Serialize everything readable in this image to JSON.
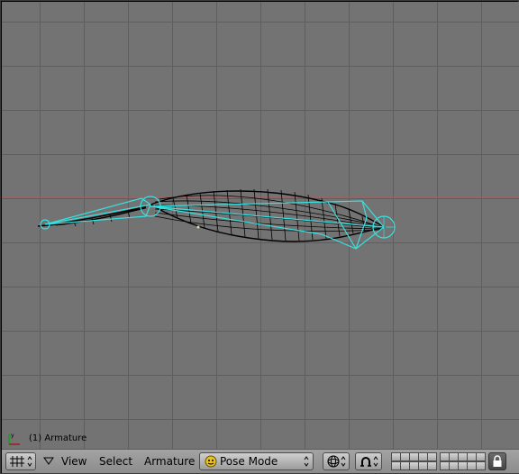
{
  "viewport": {
    "object_info": "(1) Armature",
    "axis_label": "y",
    "colors": {
      "background": "#737373",
      "grid": "#5e5e5e",
      "x_axis": "#b25a5a",
      "armature": "#38e0e0",
      "mesh": "#000000"
    }
  },
  "header": {
    "window_type_icon": "grid-icon",
    "menus": [
      "View",
      "Select",
      "Armature"
    ],
    "mode_label": "Pose Mode",
    "mode_icon": "pose-mode-icon",
    "draw_type_icon": "wire-sphere-icon",
    "pivot_icon": "horseshoe-icon",
    "lock_icon": "lock-icon"
  }
}
